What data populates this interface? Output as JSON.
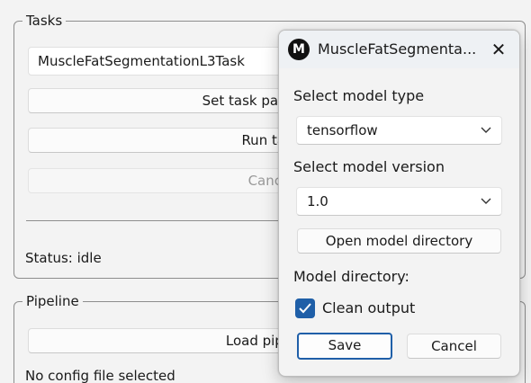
{
  "tasks": {
    "group_title": "Tasks",
    "selected_task": "MuscleFatSegmentationL3Task",
    "set_params_label": "Set task parameters",
    "run_label": "Run task",
    "cancel_label": "Cancel",
    "status": "Status: idle"
  },
  "pipeline": {
    "group_title": "Pipeline",
    "load_label": "Load pipeline",
    "config_status": "No config file selected"
  },
  "dialog": {
    "icon_letter": "M",
    "title": "MuscleFatSegmenta...",
    "close_glyph": "✕",
    "model_type_label": "Select model type",
    "model_type_value": "tensorflow",
    "model_version_label": "Select model version",
    "model_version_value": "1.0",
    "open_dir_label": "Open model directory",
    "model_dir_label": "Model directory:",
    "clean_output_label": "Clean output",
    "clean_output_checked": true,
    "save_label": "Save",
    "cancel_label": "Cancel",
    "chevron_glyph": "⌄"
  },
  "colors": {
    "accent": "#1f5fa8",
    "background": "#f3f3f3"
  },
  "icons": {
    "app": "app-logo-icon",
    "close": "close-icon",
    "dropdown": "chevron-down-icon",
    "checkmark": "checkmark-icon"
  }
}
